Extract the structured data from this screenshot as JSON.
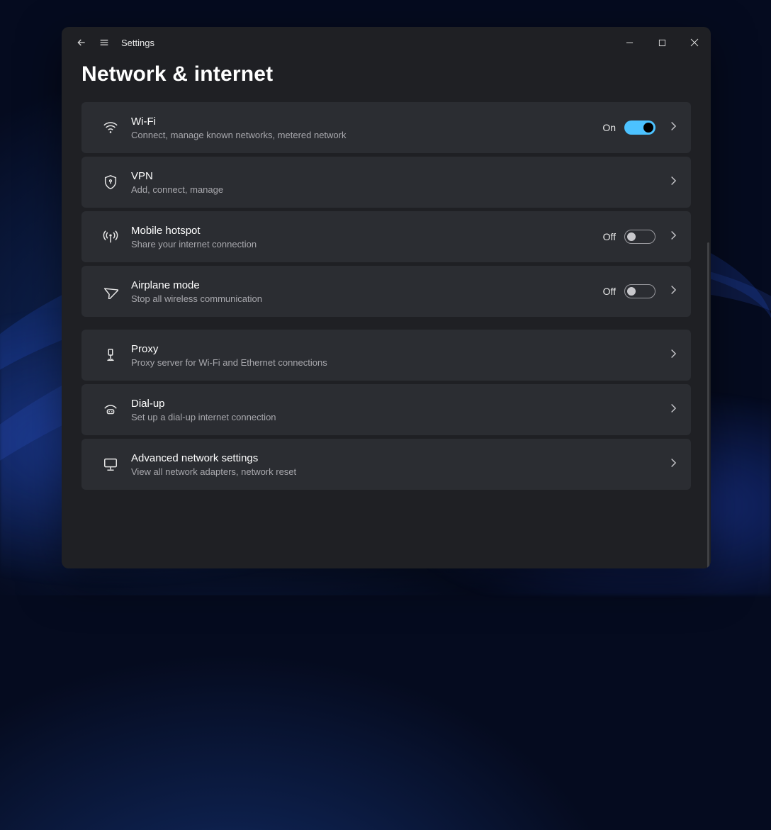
{
  "app_title": "Settings",
  "page_title": "Network & internet",
  "state_labels": {
    "on": "On",
    "off": "Off"
  },
  "rows": [
    {
      "id": "wifi",
      "icon": "wifi-icon",
      "title": "Wi-Fi",
      "sub": "Connect, manage known networks, metered network",
      "toggle": "on",
      "gap": false
    },
    {
      "id": "vpn",
      "icon": "shield-icon",
      "title": "VPN",
      "sub": "Add, connect, manage",
      "toggle": null,
      "gap": false
    },
    {
      "id": "hotspot",
      "icon": "antenna-icon",
      "title": "Mobile hotspot",
      "sub": "Share your internet connection",
      "toggle": "off",
      "gap": false
    },
    {
      "id": "airplane",
      "icon": "airplane-icon",
      "title": "Airplane mode",
      "sub": "Stop all wireless communication",
      "toggle": "off",
      "gap": true
    },
    {
      "id": "proxy",
      "icon": "proxy-icon",
      "title": "Proxy",
      "sub": "Proxy server for Wi-Fi and Ethernet connections",
      "toggle": null,
      "gap": false
    },
    {
      "id": "dialup",
      "icon": "dialup-icon",
      "title": "Dial-up",
      "sub": "Set up a dial-up internet connection",
      "toggle": null,
      "gap": false
    },
    {
      "id": "advanced",
      "icon": "monitor-icon",
      "title": "Advanced network settings",
      "sub": "View all network adapters, network reset",
      "toggle": null,
      "gap": false
    }
  ]
}
